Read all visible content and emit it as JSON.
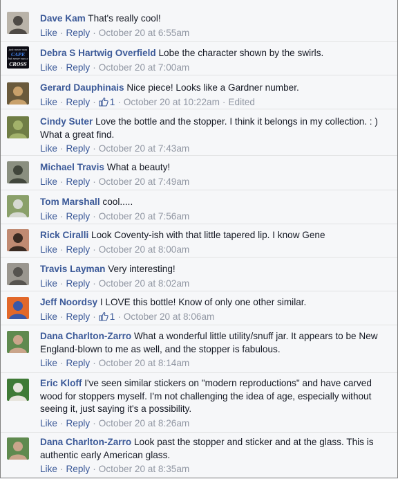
{
  "labels": {
    "like": "Like",
    "reply": "Reply",
    "sep": "·",
    "edited": "Edited"
  },
  "comments": [
    {
      "author": "Dave Kam",
      "text": "That's really cool!",
      "time": "October 20 at 6:55am",
      "likes": "",
      "edited": false,
      "avatar_colors": [
        "#b9b3a9",
        "#4e4a46"
      ]
    },
    {
      "author": "Debra S Hartwig Overfield",
      "text": "Lobe the character shown by the swirls.",
      "time": "October 20 at 7:00am",
      "likes": "",
      "edited": false,
      "avatar_colors": [
        "#0c0c14",
        "#2d6bd6"
      ],
      "avatar_words": [
        "just never was",
        "CAPE",
        "but never was a",
        "CROSS"
      ]
    },
    {
      "author": "Gerard Dauphinais",
      "text": "Nice piece! Looks like a Gardner number.",
      "time": "October 20 at 10:22am",
      "likes": "1",
      "edited": true,
      "avatar_colors": [
        "#6a5a3c",
        "#c9a16b"
      ]
    },
    {
      "author": "Cindy Suter",
      "text": "Love the bottle and the stopper. I think it belongs in my collection. : ) What a great find.",
      "time": "October 20 at 7:43am",
      "likes": "",
      "edited": false,
      "avatar_colors": [
        "#6f7d45",
        "#a2b26a"
      ]
    },
    {
      "author": "Michael Travis",
      "text": "What a beauty!",
      "time": "October 20 at 7:49am",
      "likes": "",
      "edited": false,
      "avatar_colors": [
        "#8a8f80",
        "#41463c"
      ]
    },
    {
      "author": "Tom Marshall",
      "text": "cool.....",
      "time": "October 20 at 7:56am",
      "likes": "",
      "edited": false,
      "avatar_colors": [
        "#8aa06a",
        "#d6d9d2"
      ]
    },
    {
      "author": "Rick Ciralli",
      "text": "Look Coventy-ish with that little tapered lip. I know Gene",
      "time": "October 20 at 8:00am",
      "likes": "",
      "edited": false,
      "avatar_colors": [
        "#c08a72",
        "#3a2a22"
      ]
    },
    {
      "author": "Travis Layman",
      "text": "Very interesting!",
      "time": "October 20 at 8:02am",
      "likes": "",
      "edited": false,
      "avatar_colors": [
        "#9a968f",
        "#56534f"
      ]
    },
    {
      "author": "Jeff Noordsy",
      "text": "I LOVE this bottle! Know of only one other similar.",
      "time": "October 20 at 8:06am",
      "likes": "1",
      "edited": false,
      "avatar_colors": [
        "#e2682a",
        "#3a58a8"
      ]
    },
    {
      "author": "Dana Charlton-Zarro",
      "text": "What a wonderful little utility/snuff jar. It appears to be New England-blown to me as well, and the stopper is fabulous.",
      "time": "October 20 at 8:14am",
      "likes": "",
      "edited": false,
      "avatar_colors": [
        "#5f8a4f",
        "#caa58b"
      ]
    },
    {
      "author": "Eric Kloff",
      "text": "I've seen similar stickers on \"modern reproductions\" and have carved wood for stoppers myself. I'm not challenging the idea of age, especially without seeing it, just saying it's a possibility.",
      "time": "October 20 at 8:26am",
      "likes": "",
      "edited": false,
      "avatar_colors": [
        "#3f7a36",
        "#e7e4dc"
      ]
    },
    {
      "author": "Dana Charlton-Zarro",
      "text": "Look past the stopper and sticker and at the glass. This is authentic early American glass.",
      "time": "October 20 at 8:35am",
      "likes": "",
      "edited": false,
      "avatar_colors": [
        "#5f8a4f",
        "#caa58b"
      ]
    }
  ]
}
